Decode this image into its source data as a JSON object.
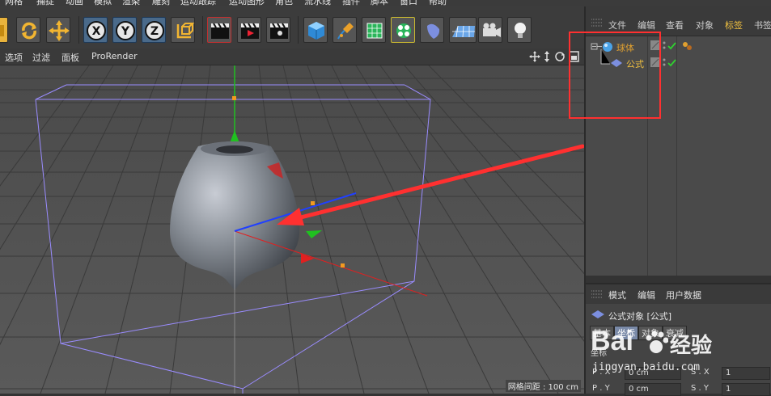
{
  "main_menu": [
    "网格",
    "捕捉",
    "动画",
    "模拟",
    "渲染",
    "雕刻",
    "运动跟踪",
    "运动图形",
    "角色",
    "流水线",
    "插件",
    "脚本",
    "窗口",
    "帮助"
  ],
  "toolbar": {
    "buttons": [
      "undo",
      "live-selection",
      "move",
      "x-axis-lock",
      "y-axis-lock",
      "z-axis-lock",
      "coordinate-system",
      "render-view",
      "render-to-picture-viewer",
      "render-settings",
      "cube",
      "pen",
      "subdivision-surface",
      "cloner",
      "deformer",
      "floor",
      "camera",
      "light"
    ],
    "axis_letters": {
      "x": "X",
      "y": "Y",
      "z": "Z"
    }
  },
  "viewport_menu": {
    "items": [
      "选项",
      "过滤",
      "面板",
      "ProRender"
    ]
  },
  "viewport": {
    "grid_spacing_label": "网格间距 : 100 cm"
  },
  "object_manager": {
    "menu": [
      "文件",
      "编辑",
      "查看",
      "对象",
      "标签",
      "书签"
    ],
    "active_menu": "标签",
    "objects": [
      {
        "name": "球体",
        "icon": "sphere-icon",
        "color": "#e0a030"
      },
      {
        "name": "公式",
        "icon": "formula-deformer-icon",
        "color": "#f0c040"
      }
    ]
  },
  "attribute_manager": {
    "menu": [
      "模式",
      "编辑",
      "用户数据"
    ],
    "title": "公式对象 [公式]",
    "tabs": [
      "基本",
      "坐标",
      "对象",
      "衰减"
    ],
    "active_tab": "坐标",
    "section_label": "坐标",
    "fields": [
      {
        "label": "P . X",
        "value": "0 cm",
        "label2": "S . X",
        "value2": "1"
      },
      {
        "label": "P . Y",
        "value": "0 cm",
        "label2": "S . Y",
        "value2": "1"
      }
    ]
  },
  "watermark": {
    "brand": "Bai",
    "suffix": "经验",
    "url": "jingyan.baidu.com"
  },
  "colors": {
    "annotation_red": "#ff3030",
    "axis_x": "#e02020",
    "axis_y": "#20c020",
    "axis_z": "#2040ff",
    "bounding_box": "#9a8cff",
    "highlight_orange": "#e0a030"
  }
}
